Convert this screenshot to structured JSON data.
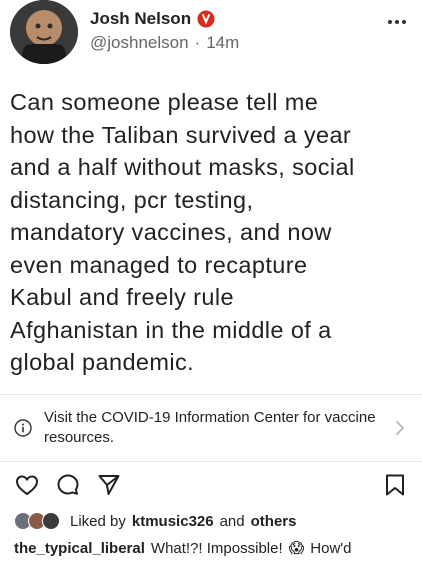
{
  "header": {
    "name": "Josh Nelson",
    "handle": "@joshnelson",
    "separator": "·",
    "time": "14m"
  },
  "post": {
    "text": "Can someone please tell me\nhow the Taliban survived a year\nand a half without masks, social\ndistancing, pcr testing,\nmandatory vaccines, and now\neven managed to recapture\nKabul and freely rule\nAfghanistan in the middle of a\nglobal pandemic."
  },
  "info_banner": {
    "text": "Visit the COVID-19 Information Center for vaccine resources."
  },
  "likes": {
    "prefix": "Liked by",
    "user": "ktmusic326",
    "middle": "and",
    "suffix": "others"
  },
  "comment": {
    "user": "the_typical_liberal",
    "text_before": "What!?! Impossible!",
    "emoji": "😱",
    "text_after": "How'd"
  },
  "colors": {
    "verified_red": "#d82b20",
    "text": "#222222",
    "secondary_text": "#666666"
  }
}
